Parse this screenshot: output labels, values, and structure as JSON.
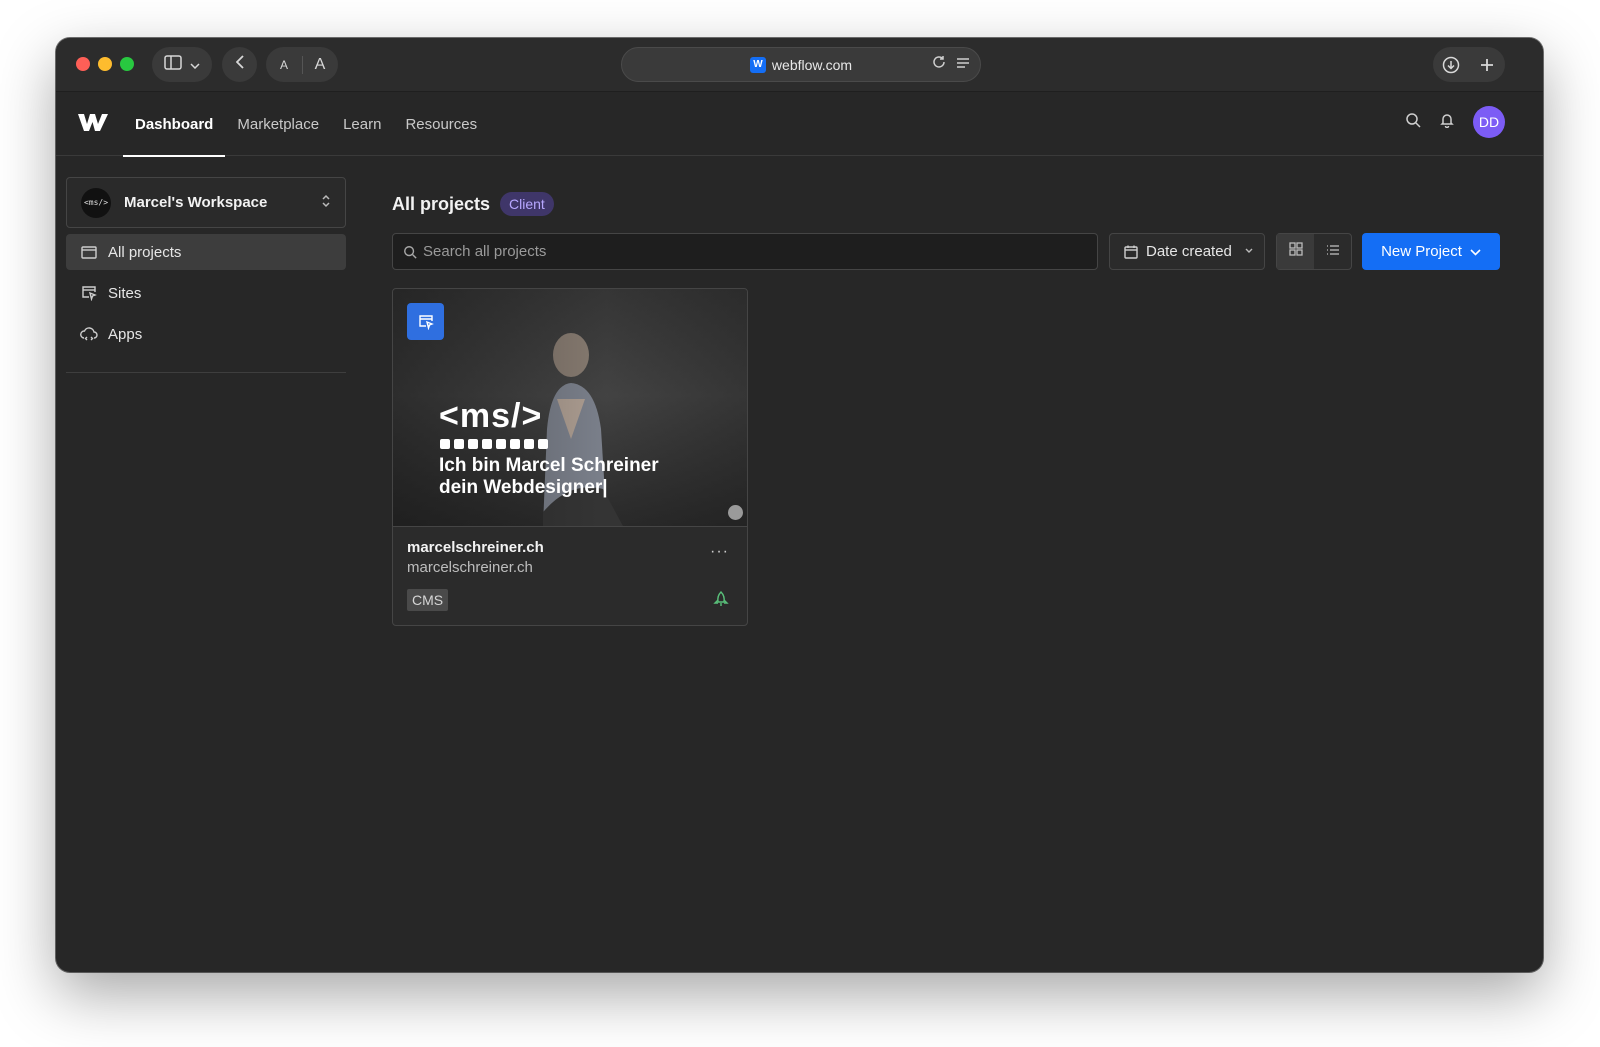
{
  "browser": {
    "url": "webflow.com",
    "text_size_small": "A",
    "text_size_large": "A"
  },
  "header": {
    "nav": [
      "Dashboard",
      "Marketplace",
      "Learn",
      "Resources"
    ],
    "avatar_initials": "DD"
  },
  "sidebar": {
    "workspace_logo": "<ms/>",
    "workspace_name": "Marcel's Workspace",
    "items": [
      {
        "label": "All projects",
        "icon": "folder-icon",
        "active": true
      },
      {
        "label": "Sites",
        "icon": "site-cursor-icon",
        "active": false
      },
      {
        "label": "Apps",
        "icon": "apps-cloud-icon",
        "active": false
      }
    ]
  },
  "main": {
    "title": "All projects",
    "badge": "Client",
    "search_placeholder": "Search all projects",
    "sort_label": "Date created",
    "view_mode": "grid",
    "new_project_label": "New Project"
  },
  "projects": [
    {
      "name": "marcelschreiner.ch",
      "domain": "marcelschreiner.ch",
      "tag": "CMS",
      "thumbnail": {
        "logo_text": "<ms/>",
        "line1": "Ich bin Marcel Schreiner",
        "line2": "dein Webdesigner|"
      }
    }
  ],
  "colors": {
    "accent": "#146ef5",
    "badge_bg": "#3f3669",
    "badge_text": "#b7a7ff",
    "avatar": "#7c5cf5",
    "published": "#59c07a"
  }
}
